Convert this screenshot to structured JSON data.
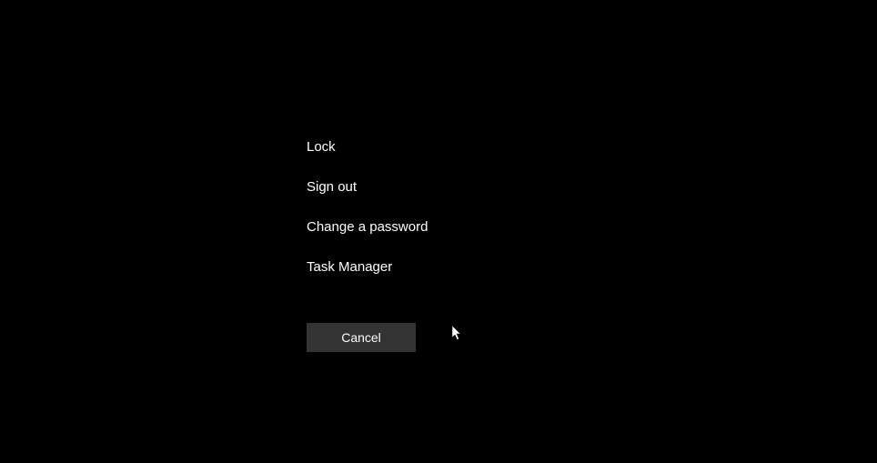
{
  "menu": {
    "items": [
      {
        "label": "Lock"
      },
      {
        "label": "Sign out"
      },
      {
        "label": "Change a password"
      },
      {
        "label": "Task Manager"
      }
    ]
  },
  "cancel": {
    "label": "Cancel"
  }
}
